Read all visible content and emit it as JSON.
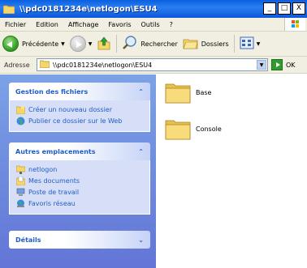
{
  "window": {
    "title": "\\\\pdc0181234e\\netlogon\\ESU4",
    "minimize": "_",
    "maximize": "□",
    "close": "X"
  },
  "menu": [
    "Fichier",
    "Edition",
    "Affichage",
    "Favoris",
    "Outils",
    "?"
  ],
  "toolbar": {
    "back_label": "Précédente",
    "search_label": "Rechercher",
    "folders_label": "Dossiers"
  },
  "address": {
    "label": "Adresse",
    "value": "\\\\pdc0181234e\\netlogon\\ESU4",
    "go_label": "OK"
  },
  "taskpane": {
    "file_tasks": {
      "title": "Gestion des fichiers",
      "links": [
        "Créer un nouveau dossier",
        "Publier ce dossier sur le Web"
      ]
    },
    "other_places": {
      "title": "Autres emplacements",
      "links": [
        "netlogon",
        "Mes documents",
        "Poste de travail",
        "Favoris réseau"
      ]
    },
    "details": {
      "title": "Détails"
    }
  },
  "files": [
    {
      "name": "Base",
      "type": "folder"
    },
    {
      "name": "Console",
      "type": "folder"
    }
  ],
  "colors": {
    "titlebar": "#0a5fe0",
    "taskpane": "#7ba2e7",
    "link": "#215dc6"
  }
}
